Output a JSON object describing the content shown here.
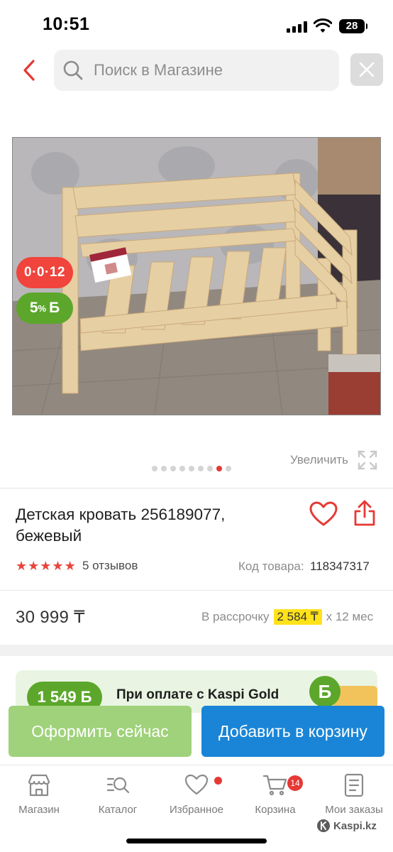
{
  "status_bar": {
    "time": "10:51",
    "battery": "28"
  },
  "search": {
    "placeholder": "Поиск в Магазине"
  },
  "product": {
    "badge_installment": "0·0·12",
    "badge_bonus_percent": "5",
    "badge_bonus_symbol": "Б",
    "zoom_label": "Увеличить",
    "gallery_dots_total": 9,
    "gallery_active_index": 7,
    "title": "Детская кровать 256189077, бежевый",
    "rating_stars": 5,
    "reviews": "5 отзывов",
    "code_label": "Код товара:",
    "code_value": "118347317",
    "price": "30 999 ₸",
    "installment_prefix": "В рассрочку",
    "installment_amount": "2 584 ₸",
    "installment_suffix": "x 12 мес"
  },
  "promo": {
    "amount": "1 549 Б",
    "text": "При оплате с Kaspi Gold",
    "coin_symbol": "Б"
  },
  "actions": {
    "checkout": "Оформить сейчас",
    "add_to_cart": "Добавить в корзину"
  },
  "tabbar": {
    "shop": "Магазин",
    "catalog": "Каталог",
    "favorites": "Избранное",
    "cart": "Корзина",
    "cart_count": "14",
    "orders": "Мои заказы"
  },
  "watermark": "Kaspi.kz",
  "colors": {
    "accent_red": "#e53935",
    "bonus_green": "#5ca72b",
    "checkout_green": "#9fd27a",
    "cart_blue": "#1a85d6",
    "installment_yellow": "#ffe21a"
  }
}
